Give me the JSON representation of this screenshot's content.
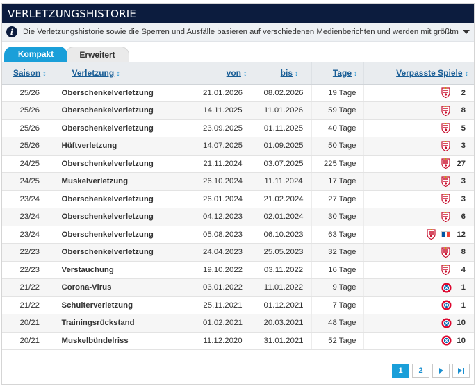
{
  "header": {
    "title": "VERLETZUNGSHISTORIE"
  },
  "info": {
    "text": "Die Verletzungshistorie sowie die Sperren und Ausfälle basieren auf verschiedenen Medienberichten und werden mit größtmöglicher Sorgfalt ..."
  },
  "tabs": [
    {
      "label": "Kompakt",
      "active": true
    },
    {
      "label": "Erweitert",
      "active": false
    }
  ],
  "table": {
    "columns": {
      "season": "Saison",
      "injury": "Verletzung",
      "from": "von",
      "until": "bis",
      "days": "Tage",
      "games": "Verpasste Spiele"
    },
    "sort_glyph": "↕",
    "rows": [
      {
        "season": "25/26",
        "injury": "Oberschenkelverletzung",
        "from": "21.01.2026",
        "until": "08.02.2026",
        "days": "19 Tage",
        "club": "sevilla",
        "flag": "",
        "games": "2"
      },
      {
        "season": "25/26",
        "injury": "Oberschenkelverletzung",
        "from": "14.11.2025",
        "until": "11.01.2026",
        "days": "59 Tage",
        "club": "sevilla",
        "flag": "",
        "games": "8"
      },
      {
        "season": "25/26",
        "injury": "Oberschenkelverletzung",
        "from": "23.09.2025",
        "until": "01.11.2025",
        "days": "40 Tage",
        "club": "sevilla",
        "flag": "",
        "games": "5"
      },
      {
        "season": "25/26",
        "injury": "Hüftverletzung",
        "from": "14.07.2025",
        "until": "01.09.2025",
        "days": "50 Tage",
        "club": "sevilla",
        "flag": "",
        "games": "3"
      },
      {
        "season": "24/25",
        "injury": "Oberschenkelverletzung",
        "from": "21.11.2024",
        "until": "03.07.2025",
        "days": "225 Tage",
        "club": "sevilla",
        "flag": "",
        "games": "27"
      },
      {
        "season": "24/25",
        "injury": "Muskelverletzung",
        "from": "26.10.2024",
        "until": "11.11.2024",
        "days": "17 Tage",
        "club": "sevilla",
        "flag": "",
        "games": "3"
      },
      {
        "season": "23/24",
        "injury": "Oberschenkelverletzung",
        "from": "26.01.2024",
        "until": "21.02.2024",
        "days": "27 Tage",
        "club": "sevilla",
        "flag": "",
        "games": "3"
      },
      {
        "season": "23/24",
        "injury": "Oberschenkelverletzung",
        "from": "04.12.2023",
        "until": "02.01.2024",
        "days": "30 Tage",
        "club": "sevilla",
        "flag": "",
        "games": "6"
      },
      {
        "season": "23/24",
        "injury": "Oberschenkelverletzung",
        "from": "05.08.2023",
        "until": "06.10.2023",
        "days": "63 Tage",
        "club": "sevilla",
        "flag": "france",
        "games": "12"
      },
      {
        "season": "22/23",
        "injury": "Oberschenkelverletzung",
        "from": "24.04.2023",
        "until": "25.05.2023",
        "days": "32 Tage",
        "club": "sevilla",
        "flag": "",
        "games": "8"
      },
      {
        "season": "22/23",
        "injury": "Verstauchung",
        "from": "19.10.2022",
        "until": "03.11.2022",
        "days": "16 Tage",
        "club": "sevilla",
        "flag": "",
        "games": "4"
      },
      {
        "season": "21/22",
        "injury": "Corona-Virus",
        "from": "03.01.2022",
        "until": "11.01.2022",
        "days": "9 Tage",
        "club": "bayern",
        "flag": "",
        "games": "1"
      },
      {
        "season": "21/22",
        "injury": "Schulterverletzung",
        "from": "25.11.2021",
        "until": "01.12.2021",
        "days": "7 Tage",
        "club": "bayern",
        "flag": "",
        "games": "1"
      },
      {
        "season": "20/21",
        "injury": "Trainingsrückstand",
        "from": "01.02.2021",
        "until": "20.03.2021",
        "days": "48 Tage",
        "club": "bayern",
        "flag": "",
        "games": "10"
      },
      {
        "season": "20/21",
        "injury": "Muskelbündelriss",
        "from": "11.12.2020",
        "until": "31.01.2021",
        "days": "52 Tage",
        "club": "bayern",
        "flag": "",
        "games": "10"
      }
    ]
  },
  "pagination": {
    "pages": [
      "1",
      "2"
    ],
    "current": "1",
    "next_icon": "next-arrow-icon",
    "last_icon": "last-page-icon"
  },
  "colors": {
    "header_bg": "#0c1c3e",
    "accent": "#1a9fd9",
    "link": "#1a5e96"
  }
}
